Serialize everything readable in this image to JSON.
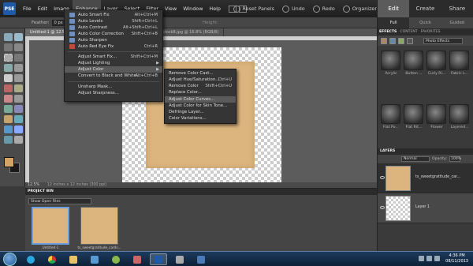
{
  "menubar": {
    "logo": "PSE",
    "items": [
      "File",
      "Edit",
      "Image",
      "Enhance",
      "Layer",
      "Select",
      "Filter",
      "View",
      "Window",
      "Help"
    ],
    "reset_panels": "Reset Panels",
    "undo": "Undo",
    "redo": "Redo",
    "organizer": "Organizer"
  },
  "options_bar": {
    "feather_label": "Feather:",
    "feather_value": "0 px",
    "height_label": "Height:"
  },
  "document": {
    "tabs": [
      "Untitled-1 @ 12.5% (...",
      "...ratitude_cardstock8.jpg @ 16.8% (RGB/8)"
    ],
    "zoom": "12.5%",
    "status": "12 inches x 12 inches (300 ppi)"
  },
  "enhance_menu": {
    "items": [
      {
        "label": "Auto Smart Fix",
        "shortcut": "Alt+Ctrl+M"
      },
      {
        "label": "Auto Levels",
        "shortcut": "Shift+Ctrl+L"
      },
      {
        "label": "Auto Contrast",
        "shortcut": "Alt+Shift+Ctrl+L"
      },
      {
        "label": "Auto Color Correction",
        "shortcut": "Shift+Ctrl+B"
      },
      {
        "label": "Auto Sharpen",
        "shortcut": ""
      },
      {
        "label": "Auto Red Eye Fix",
        "shortcut": "Ctrl+R"
      },
      {
        "label": "Adjust Smart Fix...",
        "shortcut": "Shift+Ctrl+M"
      },
      {
        "label": "Adjust Lighting",
        "shortcut": ""
      },
      {
        "label": "Adjust Color",
        "shortcut": ""
      },
      {
        "label": "Convert to Black and White...",
        "shortcut": "Alt+Ctrl+B"
      },
      {
        "label": "Unsharp Mask...",
        "shortcut": ""
      },
      {
        "label": "Adjust Sharpness...",
        "shortcut": ""
      }
    ]
  },
  "adjust_color_submenu": {
    "items": [
      {
        "label": "Remove Color Cast...",
        "shortcut": ""
      },
      {
        "label": "Adjust Hue/Saturation...",
        "shortcut": "Ctrl+U"
      },
      {
        "label": "Remove Color",
        "shortcut": "Shift+Ctrl+U"
      },
      {
        "label": "Replace Color...",
        "shortcut": ""
      },
      {
        "label": "Adjust Color Curves...",
        "shortcut": ""
      },
      {
        "label": "Adjust Color for Skin Tone...",
        "shortcut": ""
      },
      {
        "label": "Defringe Layer...",
        "shortcut": ""
      },
      {
        "label": "Color Variations...",
        "shortcut": ""
      }
    ]
  },
  "right_panel": {
    "mode_tabs": [
      "Edit",
      "Create",
      "Share"
    ],
    "sub_tabs": [
      "Full",
      "Quick",
      "Guided"
    ],
    "effects_tabs": [
      "EFFECTS",
      "CONTENT",
      "FAVORITES"
    ],
    "effects_filter": "Photo Effects",
    "effect_labels": [
      "Acrylic",
      "Button ...",
      "Curly Ri...",
      "Fabric L...",
      "Flat Pu...",
      "Flat Rit...",
      "Flower",
      "Layered..."
    ],
    "layers_title": "LAYERS",
    "blend_mode": "Normal",
    "opacity_label": "Opacity:",
    "opacity_value": "100%",
    "layers": [
      "ts_sweetgratitude_car...",
      "Layer 1"
    ],
    "lock_label": "Lock:"
  },
  "project_bin": {
    "title": "PROJECT BIN",
    "filter": "Show Open Files",
    "items": [
      "Untitled-1",
      "ts_sweetgratitude_cards..."
    ]
  },
  "taskbar": {
    "time": "4:36 PM",
    "date": "08/11/2013"
  },
  "colors": {
    "foreground": "#d4a466",
    "background": "#1a1a1a",
    "paper": "#dcb57e"
  }
}
